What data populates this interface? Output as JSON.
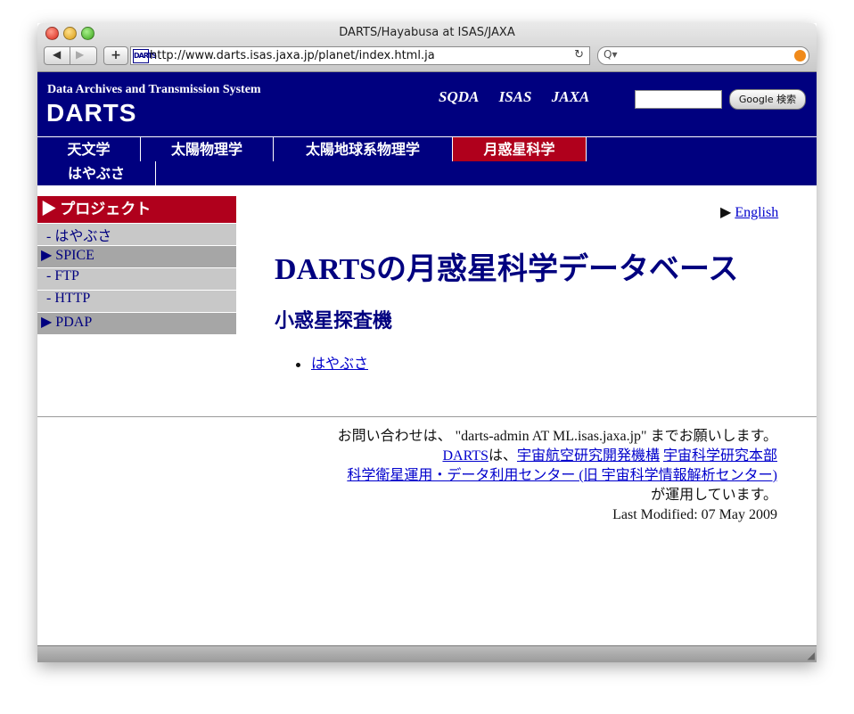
{
  "window": {
    "title": "DARTS/Hayabusa at ISAS/JAXA"
  },
  "toolbar": {
    "back_glyph": "◀",
    "forward_glyph": "▶",
    "add_glyph": "+",
    "favicon_text": "DARTS",
    "url": "http://www.darts.isas.jaxa.jp/planet/index.html.ja",
    "reload_glyph": "↻",
    "search_glyph": "Q▾",
    "search_value": ""
  },
  "header": {
    "subtitle": "Data Archives and Transmission System",
    "logo": "DARTS",
    "partner_logos": [
      "SQDA",
      "ISAS",
      "JAXA"
    ],
    "search_button": "Google 検索",
    "search_value": ""
  },
  "topnav": {
    "items": [
      {
        "label": "天文学"
      },
      {
        "label": "太陽物理学"
      },
      {
        "label": "太陽地球系物理学"
      },
      {
        "label": "月惑星科学"
      }
    ]
  },
  "subnav": {
    "items": [
      {
        "label": "はやぶさ"
      }
    ]
  },
  "sidebar": {
    "items": [
      {
        "label": "▶ プロジェクト"
      },
      {
        "label": "- はやぶさ"
      },
      {
        "label": "▶ SPICE"
      },
      {
        "label": "- FTP"
      },
      {
        "label": "- HTTP"
      },
      {
        "label": "▶ PDAP"
      }
    ]
  },
  "main": {
    "lang_arrow": "▶ ",
    "lang_link": "English",
    "title": "DARTSの月惑星科学データベース",
    "section": "小惑星探査機",
    "links": [
      "はやぶさ"
    ]
  },
  "footer": {
    "contact": "お問い合わせは、 \"darts-admin AT ML.isas.jaxa.jp\" までお願いします。",
    "darts_link": "DARTS",
    "wa": "は、",
    "jaxa_link": "宇宙航空研究開発機構",
    "isas_link": "宇宙科学研究本部",
    "center_link": "科学衛星運用・データ利用センター (旧 宇宙科学情報解析センター)",
    "operated": "が運用しています。",
    "last_modified": "Last Modified: 07 May 2009"
  },
  "colors": {
    "navy": "#00007f",
    "accent_red": "#b0001c",
    "menu_grey": "#c8c8c8",
    "menu_dark_grey": "#a6a6a6"
  }
}
